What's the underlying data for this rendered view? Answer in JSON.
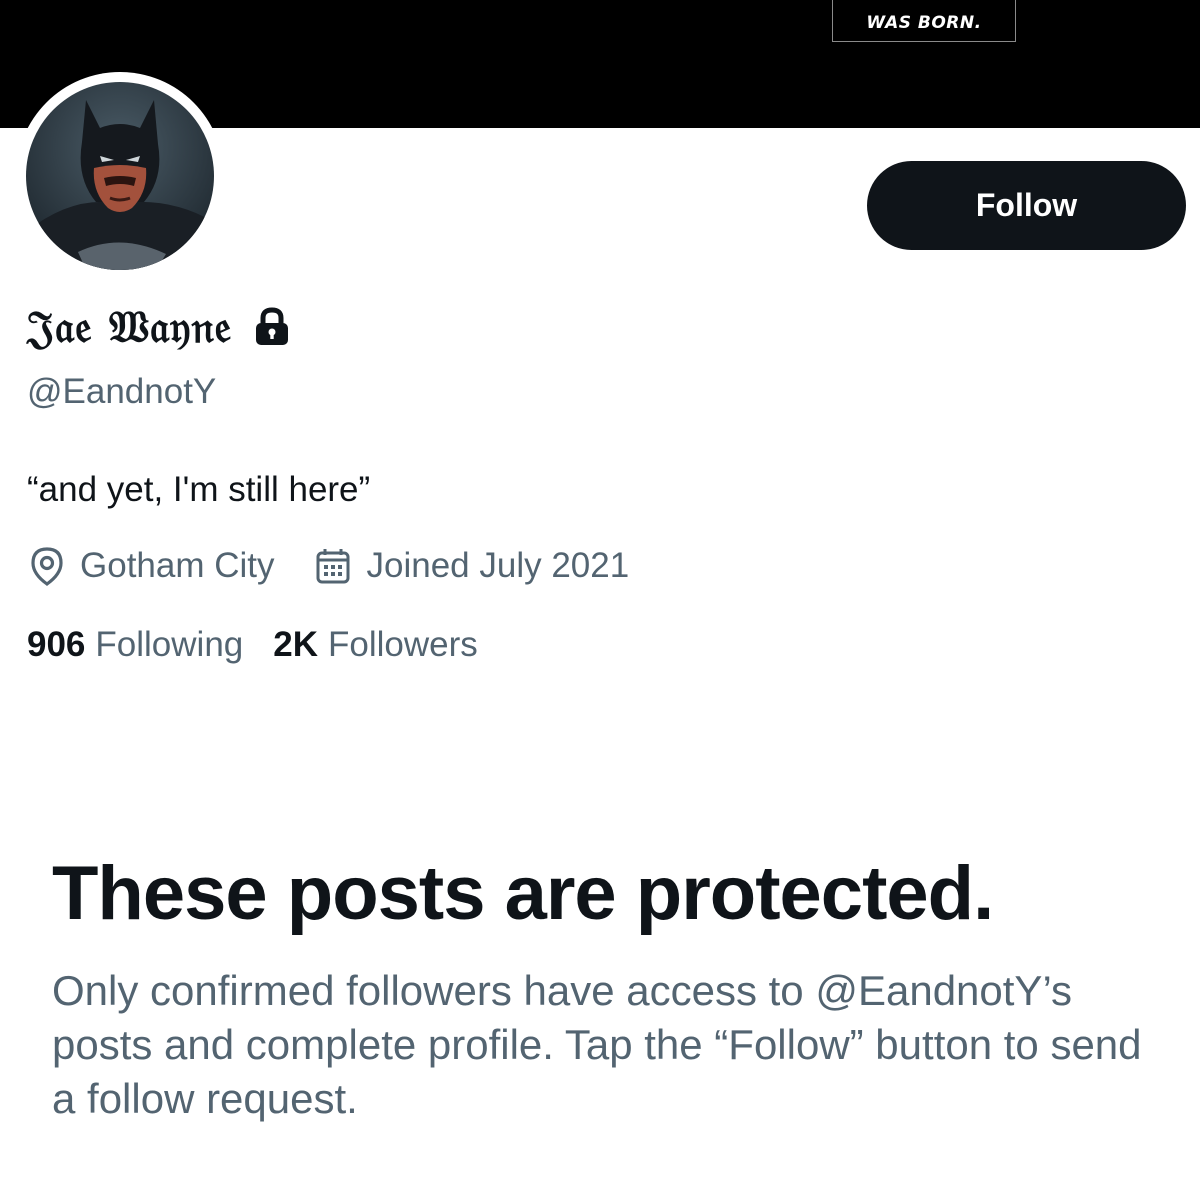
{
  "banner": {
    "caption": "WAS BORN."
  },
  "profile": {
    "avatar_icon": "batman-avatar",
    "display_name": "𝔍𝔞𝔢 𝔚𝔞𝔶𝔫𝔢",
    "protected_icon": "lock-icon",
    "handle": "@EandnotY",
    "bio": "“and yet, I'm still here”",
    "location_icon": "location-pin-icon",
    "location": "Gotham City",
    "joined_icon": "calendar-icon",
    "joined": "Joined July 2021",
    "following_count": "906",
    "following_label": "Following",
    "followers_count": "2K",
    "followers_label": "Followers"
  },
  "actions": {
    "follow_label": "Follow"
  },
  "protected_notice": {
    "title": "These posts are protected.",
    "description": "Only confirmed followers have access to @EandnotY’s posts and complete profile. Tap the “Follow” button to send a follow request."
  },
  "colors": {
    "text_primary": "#0f1419",
    "text_secondary": "#536471",
    "button_bg": "#0f1419",
    "banner_bg": "#000000"
  }
}
